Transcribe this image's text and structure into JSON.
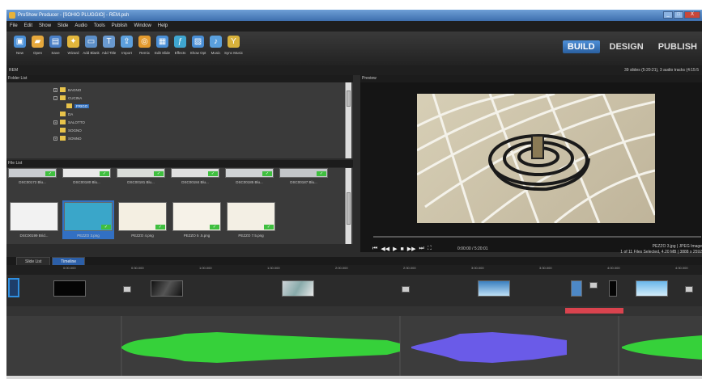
{
  "window": {
    "title": "ProShow Producer - [SOHIO PLUGGIO] - REM.psh",
    "buttons": [
      "_",
      "□",
      "X"
    ]
  },
  "menu": [
    "File",
    "Edit",
    "Show",
    "Slide",
    "Audio",
    "Tools",
    "Publish",
    "Window",
    "Help"
  ],
  "toolbar": [
    {
      "label": "New",
      "icon": "new-show-icon",
      "color": "#4a8fd6"
    },
    {
      "label": "Open",
      "icon": "open-folder-icon",
      "color": "#e6a83c"
    },
    {
      "label": "Save",
      "icon": "save-icon",
      "color": "#4a7fc6"
    },
    {
      "label": "Wizard",
      "icon": "wizard-icon",
      "color": "#e2b63c"
    },
    {
      "label": "Add Blank",
      "icon": "add-blank-icon",
      "color": "#5c8fc8"
    },
    {
      "label": "Add Title",
      "icon": "add-title-icon",
      "color": "#6a9ad0"
    },
    {
      "label": "Import",
      "icon": "import-icon",
      "color": "#5da0dd"
    },
    {
      "label": "Remix",
      "icon": "remix-icon",
      "color": "#e39a2e"
    },
    {
      "label": "Edit Slide",
      "icon": "edit-slide-icon",
      "color": "#4a8fd6"
    },
    {
      "label": "Effects",
      "icon": "effects-icon",
      "color": "#3fa6d0"
    },
    {
      "label": "Show Opt",
      "icon": "show-options-icon",
      "color": "#4a8fd6"
    },
    {
      "label": "Music",
      "icon": "music-icon",
      "color": "#5aa0dd"
    },
    {
      "label": "Sync Music",
      "icon": "sync-music-icon",
      "color": "#d8b23c"
    }
  ],
  "modes": {
    "build": "BUILD",
    "design": "DESIGN",
    "publish": "PUBLISH"
  },
  "infobar": {
    "show_name": "REM",
    "summary": "39 slides (5:20:21), 3 audio tracks (4:15:5"
  },
  "folder_list": {
    "title": "Folder List",
    "items": [
      {
        "label": "BAGNO",
        "indent": 1,
        "expander": "+",
        "selected": false
      },
      {
        "label": "CUCINA",
        "indent": 1,
        "expander": "-",
        "selected": false
      },
      {
        "label": "FRIGO",
        "indent": 2,
        "expander": "",
        "selected": true
      },
      {
        "label": "DA",
        "indent": 1,
        "expander": "",
        "selected": false
      },
      {
        "label": "SALOTTO",
        "indent": 1,
        "expander": "+",
        "selected": false
      },
      {
        "label": "SOGNO",
        "indent": 1,
        "expander": "",
        "selected": false
      },
      {
        "label": "SONNO",
        "indent": 1,
        "expander": "+",
        "selected": false
      }
    ]
  },
  "file_list": {
    "title": "File List",
    "row1": [
      "DSC00172 Blu...",
      "DSC00180 Blu...",
      "DSC00181 Blu...",
      "DSC00184 Blu...",
      "DSC00185 Blu...",
      "DSC00187 Blu..."
    ],
    "row2": [
      "DSC00199 Brid...",
      "PEZZO 3.png",
      "PEZZO 4.png",
      "PEZZO 5 .5.png",
      "PEZZO 7.5.png"
    ]
  },
  "preview": {
    "title": "Preview",
    "timecode": "0:00:00 / 5:20:01",
    "file_line1": "PEZZO 3.jpg | JPEG Image",
    "file_line2": "1 of 11 Files Selected, 4.20 MB | 3888 x 2592",
    "transport": [
      "⏮",
      "◀◀",
      "▶",
      "■",
      "▶▶",
      "⏭",
      "⛶"
    ]
  },
  "tabs": {
    "slide_list": "Slide List",
    "timeline": "Timeline"
  },
  "ruler": [
    "0:00.000",
    "0:30.000",
    "1:00.000",
    "1:30.000",
    "2:00.000",
    "2:30.000",
    "3:00.000",
    "3:30.000",
    "4:00.000",
    "4:30.000"
  ],
  "colors": {
    "accent": "#2c6cc4",
    "wave_green": "#36d13a",
    "wave_purple": "#6a5be8",
    "wave_red": "#e8505a"
  }
}
